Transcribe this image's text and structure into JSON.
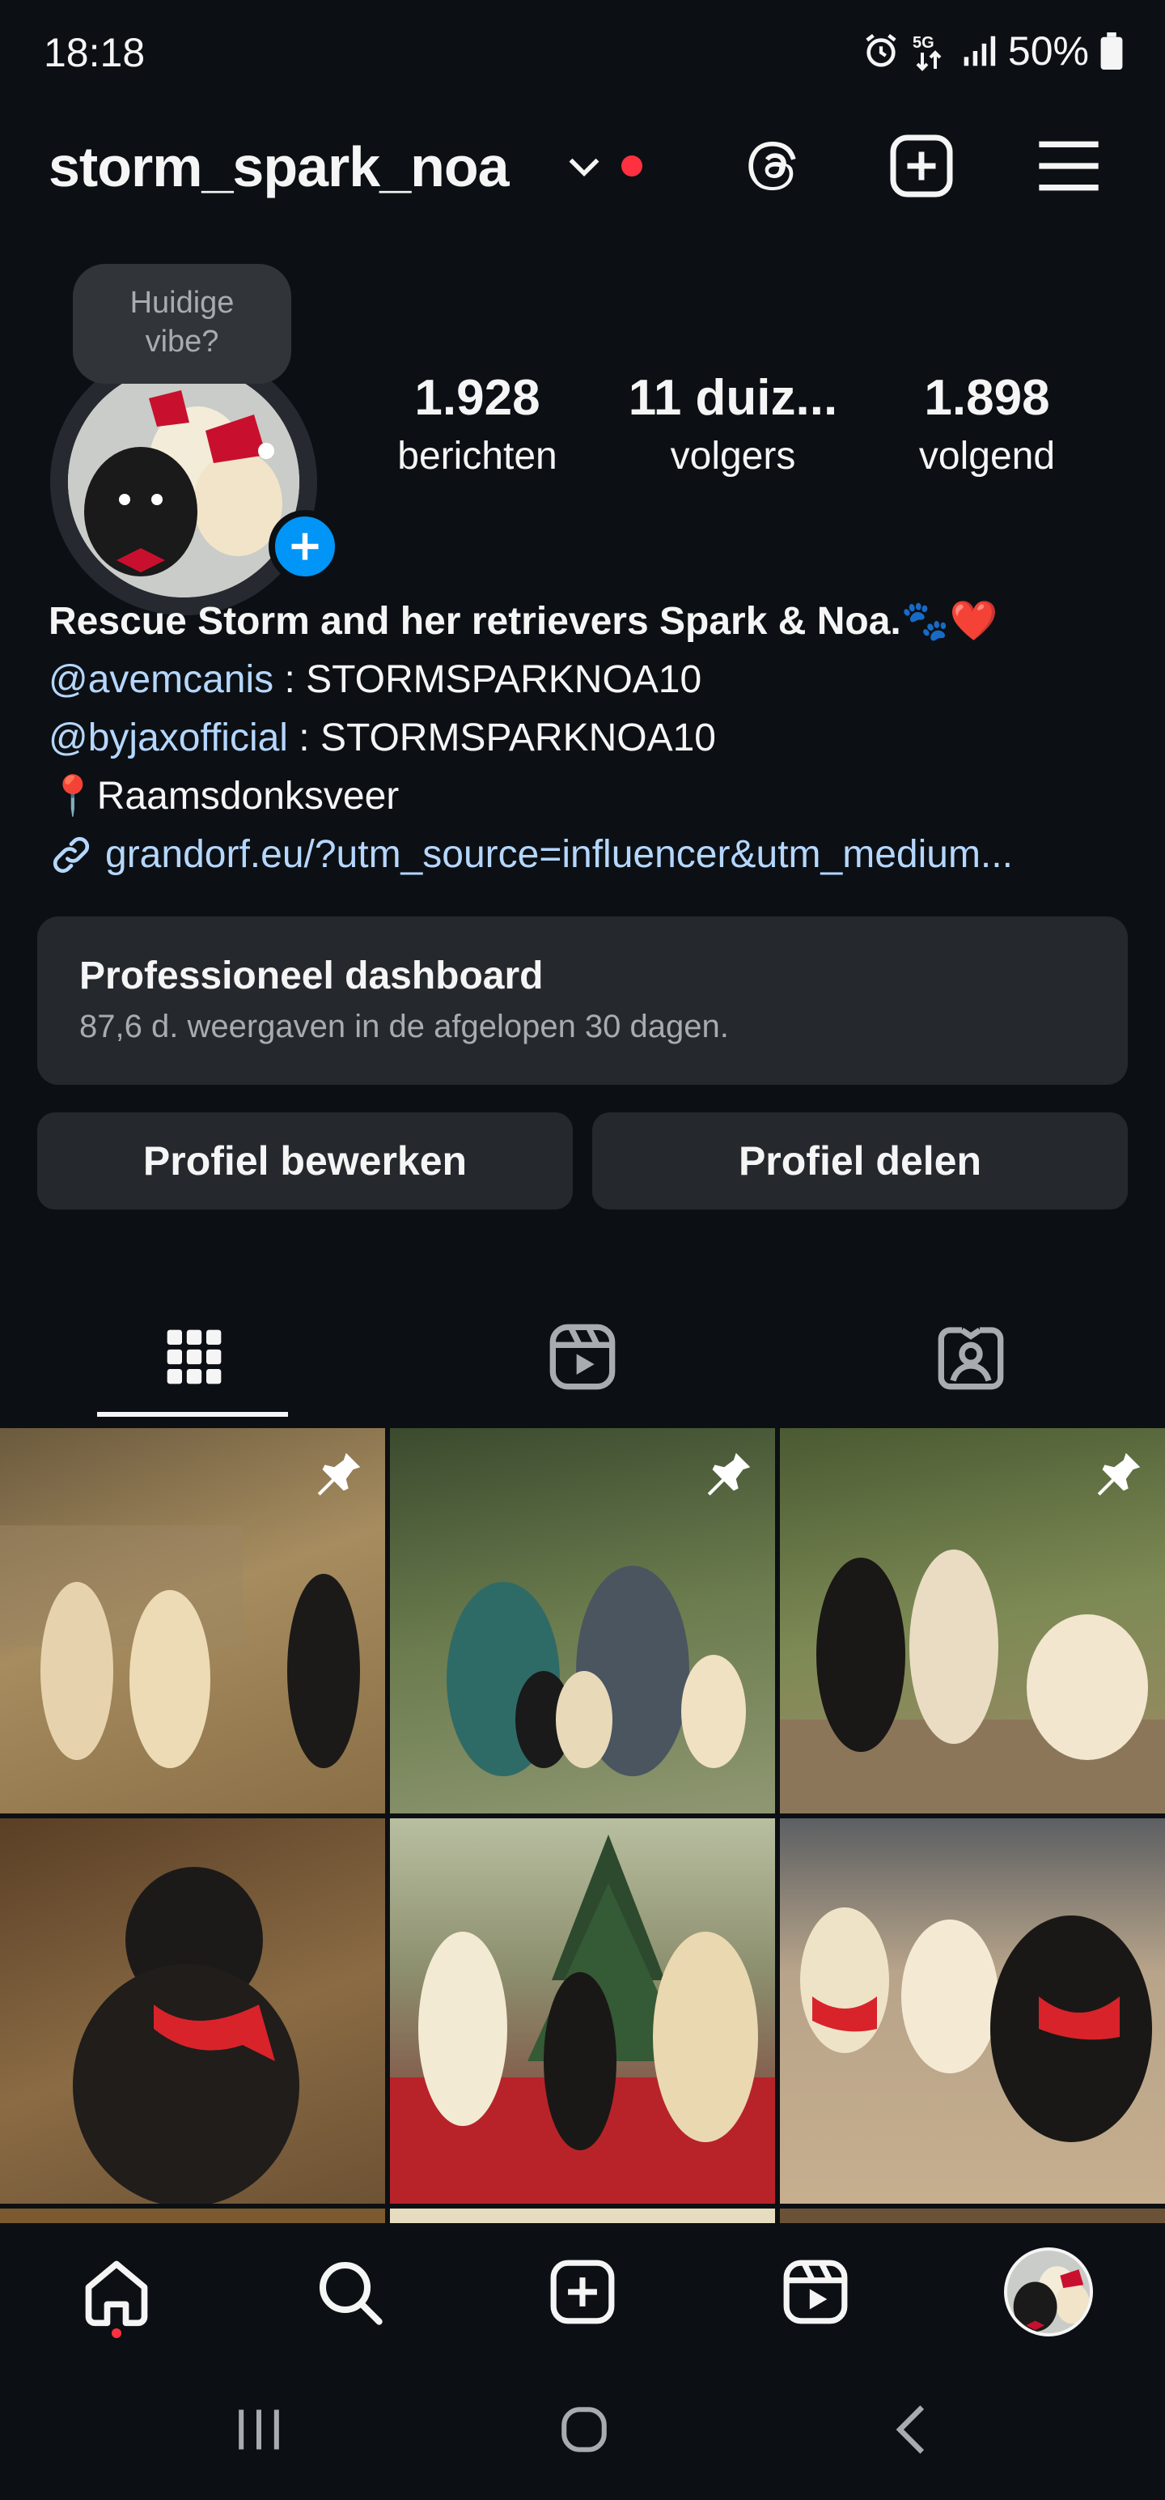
{
  "status_bar": {
    "time": "18:18",
    "network": "5G",
    "battery": "50%"
  },
  "header": {
    "username": "storm_spark_noa",
    "icons": [
      "chevron-down-icon",
      "threads-icon",
      "create-icon",
      "menu-icon"
    ]
  },
  "profile": {
    "note_bubble": "Huidige vibe?",
    "stats": [
      {
        "value": "1.928",
        "label": "berichten"
      },
      {
        "value": "11 duiz...",
        "label": "volgers"
      },
      {
        "value": "1.898",
        "label": "volgend"
      }
    ],
    "bio": {
      "name_line": "Rescue Storm and her retrievers Spark & Noa.🐾❤️",
      "mention1": "@avemcanis",
      "code1": " : STORMSPARKNOA10",
      "mention2": "@byjaxofficial",
      "code2": " : STORMSPARKNOA10",
      "location": "📍Raamsdonksveer",
      "link": "grandorf.eu/?utm_source=influencer&utm_medium..."
    }
  },
  "dashboard": {
    "title": "Professioneel dashboard",
    "subtitle": "87,6 d. weergaven in de afgelopen 30 dagen."
  },
  "buttons": {
    "edit": "Profiel bewerken",
    "share": "Profiel delen"
  },
  "tabs": [
    "grid-icon",
    "reels-icon",
    "tagged-icon"
  ],
  "colors": {
    "background": "#0c1014",
    "card": "#25292e",
    "accent": "#0095f6",
    "notification": "#ff3040",
    "link": "#b5d7ff"
  },
  "grid": {
    "pinned_count": 3,
    "visible_posts": 6
  },
  "bottom_nav": [
    "home-icon",
    "search-icon",
    "create-icon",
    "reels-icon",
    "profile-avatar"
  ]
}
